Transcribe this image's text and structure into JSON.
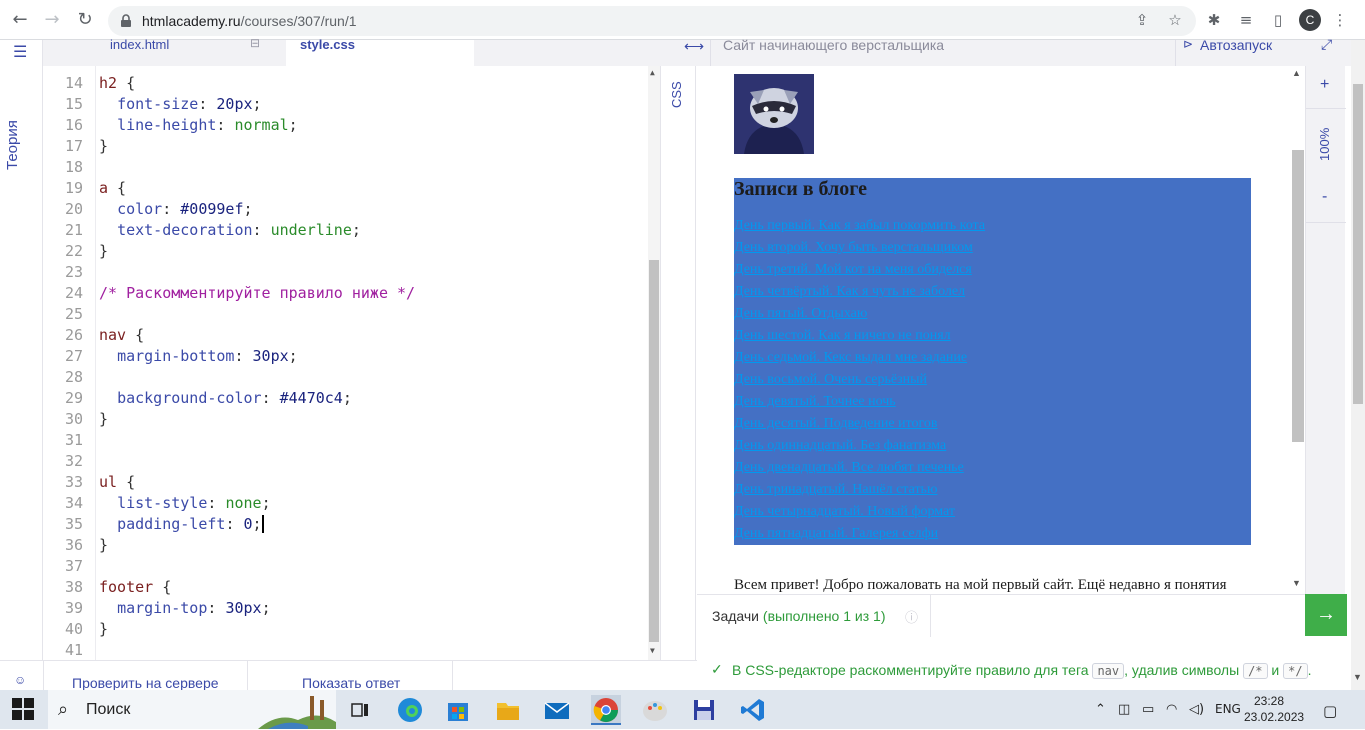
{
  "browser": {
    "url_domain": "htmlacademy.ru",
    "url_path": "/courses/307/run/1",
    "profile_initial": "C"
  },
  "rail": {
    "theory_label": "Теория"
  },
  "editor": {
    "tabs": [
      {
        "label": "index.html"
      },
      {
        "label": "style.css"
      }
    ],
    "css_label": "CSS",
    "lines": [
      {
        "n": "14",
        "html": "<span class='sel'>h2</span> {"
      },
      {
        "n": "15",
        "html": "  <span class='prop'>font-size</span>: <span class='num'>20px</span>;"
      },
      {
        "n": "16",
        "html": "  <span class='prop'>line-height</span>: <span class='kw'>normal</span>;"
      },
      {
        "n": "17",
        "html": "}"
      },
      {
        "n": "18",
        "html": ""
      },
      {
        "n": "19",
        "html": "<span class='sel'>a</span> {"
      },
      {
        "n": "20",
        "html": "  <span class='prop'>color</span>: <span class='num'>#0099ef</span>;"
      },
      {
        "n": "21",
        "html": "  <span class='prop'>text-decoration</span>: <span class='kw'>underline</span>;"
      },
      {
        "n": "22",
        "html": "}"
      },
      {
        "n": "23",
        "html": ""
      },
      {
        "n": "24",
        "html": "<span class='cmt'>/* Раскомментируйте правило ниже */</span>"
      },
      {
        "n": "25",
        "html": ""
      },
      {
        "n": "26",
        "html": "<span class='sel'>nav</span> {"
      },
      {
        "n": "27",
        "html": "  <span class='prop'>margin-bottom</span>: <span class='num'>30px</span>;"
      },
      {
        "n": "28",
        "html": ""
      },
      {
        "n": "29",
        "html": "  <span class='prop'>background-color</span>: <span class='num'>#4470c4</span>;"
      },
      {
        "n": "30",
        "html": "}"
      },
      {
        "n": "31",
        "html": ""
      },
      {
        "n": "32",
        "html": ""
      },
      {
        "n": "33",
        "html": "<span class='sel'>ul</span> {"
      },
      {
        "n": "34",
        "html": "  <span class='prop'>list-style</span>: <span class='kw'>none</span>;"
      },
      {
        "n": "35",
        "html": "  <span class='prop'>padding-left</span>: <span class='num'>0</span>;<span style='border-left:2px solid #000;'></span>"
      },
      {
        "n": "36",
        "html": "}"
      },
      {
        "n": "37",
        "html": ""
      },
      {
        "n": "38",
        "html": "<span class='sel'>footer</span> {"
      },
      {
        "n": "39",
        "html": "  <span class='prop'>margin-top</span>: <span class='num'>30px</span>;"
      },
      {
        "n": "40",
        "html": "}"
      },
      {
        "n": "41",
        "html": ""
      }
    ]
  },
  "preview_header": {
    "title": "Сайт начинающего верстальщика",
    "autorun": "Автозапуск",
    "zoom": "100%"
  },
  "preview": {
    "heading": "Записи в блоге",
    "links": [
      "День первый. Как я забыл покормить кота",
      "День второй. Хочу быть верстальщиком",
      "День третий. Мой кот на меня обиделся",
      "День четвёртый. Как я чуть не заболел",
      "День пятый. Отдыхаю",
      "День шестой. Как я ничего не понял",
      "День седьмой. Кекс выдал мне задание",
      "День восьмой. Очень серьёзный",
      "День девятый. Точнее ночь",
      "День десятый. Подведение итогов",
      "День одиннадцатый. Без фанатизма",
      "День двенадцатый. Все любят печенье",
      "День тринадцатый. Нашёл статью",
      "День четырнадцатый. Новый формат",
      "День пятнадцатый. Галерея селфи"
    ],
    "intro": "Всем привет! Добро пожаловать на мой первый сайт. Ещё недавно я понятия"
  },
  "tasks": {
    "label": "Задачи",
    "status": "(выполнено 1 из 1)",
    "task_before": "В CSS-редакторе раскомментируйте правило для тега",
    "task_code1": "nav",
    "task_mid": ", удалив символы",
    "task_code2": "/*",
    "task_and": "и",
    "task_code3": "*/",
    "task_end": "."
  },
  "bottom": {
    "check": "Проверить на сервере",
    "answer": "Показать ответ"
  },
  "taskbar": {
    "search": "Поиск",
    "lang": "ENG",
    "time": "23:28",
    "date": "23.02.2023"
  },
  "colors": {
    "accent": "#3b4aa8",
    "nav_bg": "#4470c4",
    "link": "#0099ef",
    "success": "#3fae49"
  }
}
